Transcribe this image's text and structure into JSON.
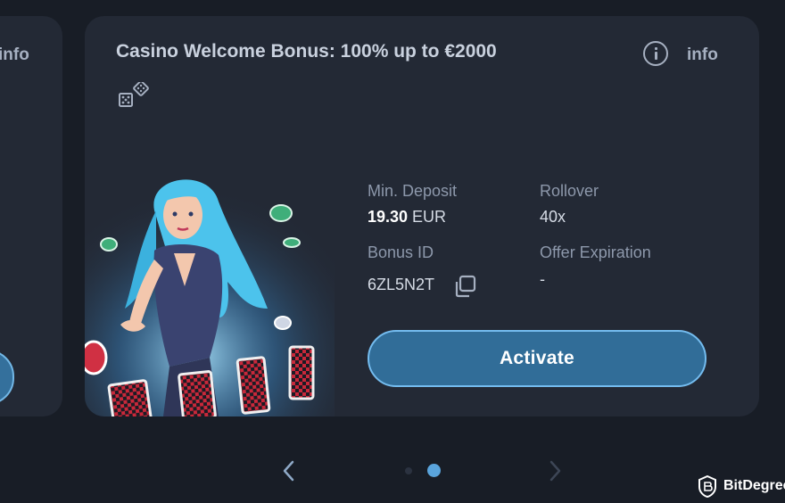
{
  "prev_card": {
    "info_label": "info"
  },
  "offer": {
    "title": "Casino Welcome Bonus: 100% up to €2000",
    "info_label": "info",
    "min_deposit_label": "Min. Deposit",
    "min_deposit_amount": "19.30",
    "min_deposit_currency": " EUR",
    "rollover_label": "Rollover",
    "rollover_value": "40x",
    "bonus_id_label": "Bonus ID",
    "bonus_id_value": "6ZL5N2T",
    "expiration_label": "Offer Expiration",
    "expiration_value": "-",
    "activate_label": "Activate"
  },
  "carousel": {
    "pages": 2,
    "active_page": 2
  },
  "brand": {
    "name": "BitDegree"
  },
  "colors": {
    "background": "#181d26",
    "card": "#232935",
    "accent": "#316d98",
    "accent_border": "#74bcef",
    "active_dot": "#5aa4dc"
  },
  "icons": [
    "dice-icon",
    "info-icon",
    "copy-icon",
    "chevron-left-icon",
    "chevron-right-icon",
    "bitdegree-logo-icon"
  ]
}
